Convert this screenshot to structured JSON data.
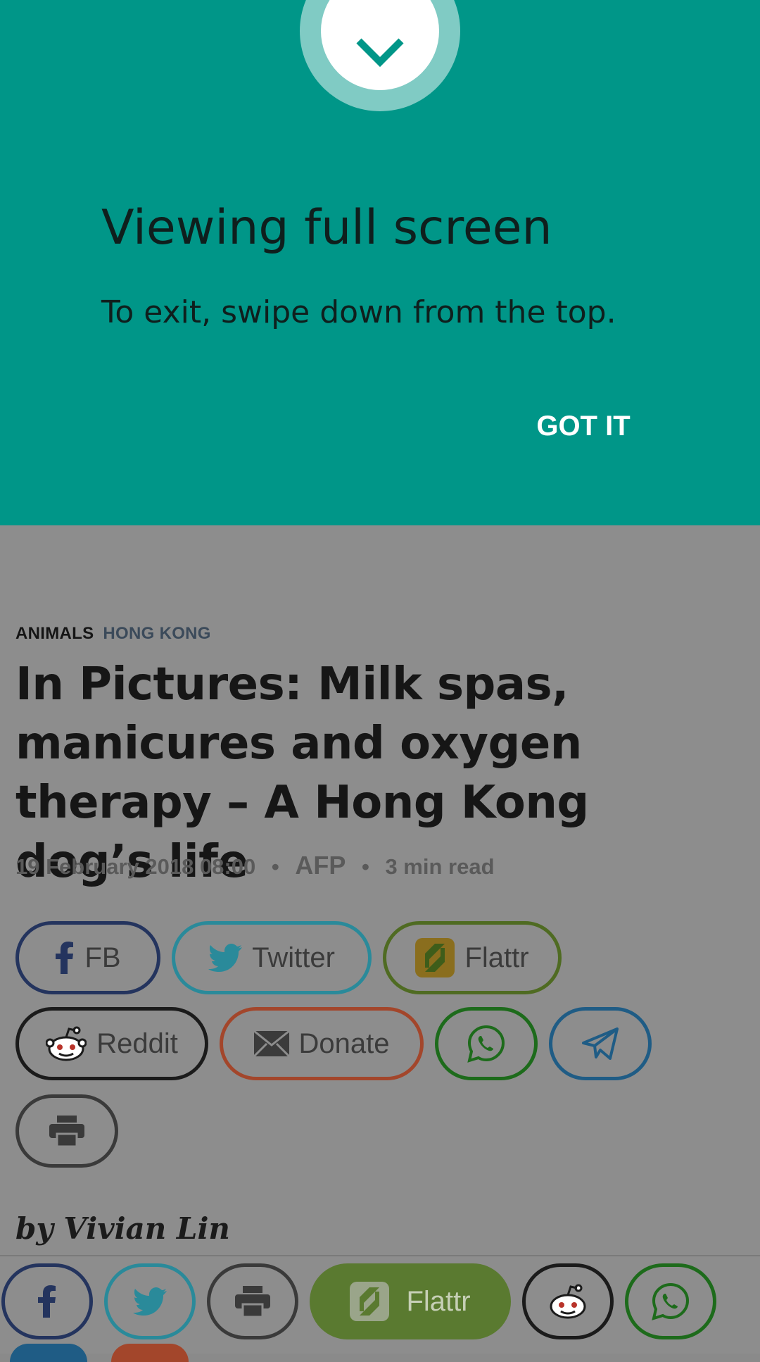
{
  "overlay": {
    "title": "Viewing full screen",
    "subtitle": "To exit, swipe down from the top.",
    "button": "GOT IT",
    "icon": "chevron-down-icon",
    "color": "#009688"
  },
  "article": {
    "categories": [
      "ANIMALS",
      "HONG KONG"
    ],
    "headline": "In Pictures: Milk spas, manicures and oxygen therapy – A Hong Kong dog’s life",
    "date": "19 February 2018 08:00",
    "separator": "•",
    "source": "AFP",
    "read_time": "3 min read",
    "byline": "by Vivian Lin"
  },
  "share_buttons": [
    {
      "label": "FB",
      "icon": "facebook-icon",
      "color": "#24345e"
    },
    {
      "label": "Twitter",
      "icon": "twitter-icon",
      "color": "#2a8a9a"
    },
    {
      "label": "Flattr",
      "icon": "flattr-icon",
      "color": "#4f6b22"
    },
    {
      "label": "Reddit",
      "icon": "reddit-icon",
      "color": "#1b1b1b"
    },
    {
      "label": "Donate",
      "icon": "envelope-icon",
      "color": "#a3462b"
    },
    {
      "label": "",
      "icon": "whatsapp-icon",
      "color": "#1d6b1b"
    },
    {
      "label": "",
      "icon": "telegram-icon",
      "color": "#1f5c85"
    },
    {
      "label": "",
      "icon": "print-icon",
      "color": "#3a3a3a"
    }
  ],
  "bottom_bar": {
    "flattr_label": "Flattr",
    "icons": [
      "facebook-icon",
      "twitter-icon",
      "print-icon",
      "flattr-icon",
      "reddit-icon",
      "whatsapp-icon"
    ]
  }
}
